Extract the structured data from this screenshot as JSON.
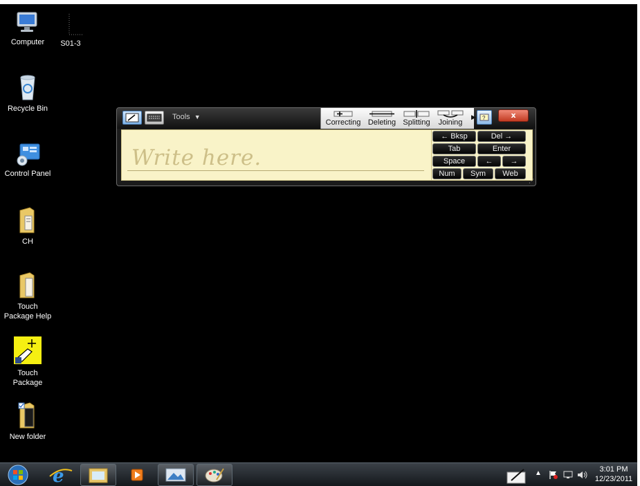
{
  "desktop": {
    "icons": [
      {
        "label": "Computer",
        "icon": "computer-icon"
      },
      {
        "label": "S01-3",
        "icon": "shortcut-file-icon"
      },
      {
        "label": "Recycle Bin",
        "icon": "recycle-bin-icon"
      },
      {
        "label": "Control Panel",
        "icon": "control-panel-icon"
      },
      {
        "label": "CH",
        "icon": "folder-icon"
      },
      {
        "label": "Touch\nPackage Help",
        "icon": "folder-icon"
      },
      {
        "label": "Touch\nPackage",
        "icon": "touch-package-icon"
      },
      {
        "label": "New folder",
        "icon": "folder-icon"
      }
    ]
  },
  "input_panel": {
    "tools_label": "Tools",
    "gestures": [
      "Correcting",
      "Deleting",
      "Splitting",
      "Joining"
    ],
    "close_label": "x",
    "placeholder": "Write here.",
    "keys": {
      "bksp": "← Bksp",
      "del": "Del →",
      "tab": "Tab",
      "enter": "Enter",
      "space": "Space",
      "left": "←",
      "right": "→",
      "num": "Num",
      "sym": "Sym",
      "web": "Web"
    }
  },
  "taskbar": {
    "items": [
      "start-orb-icon",
      "internet-explorer-icon",
      "file-explorer-icon",
      "media-player-icon",
      "image-viewer-icon",
      "paint-icon"
    ],
    "clock": {
      "time": "3:01 PM",
      "date": "12/23/2011"
    }
  },
  "colors": {
    "desktop": "#000000",
    "pad": "#f9f3c8",
    "accent": "#4b7fb8",
    "close": "#c23b22"
  }
}
